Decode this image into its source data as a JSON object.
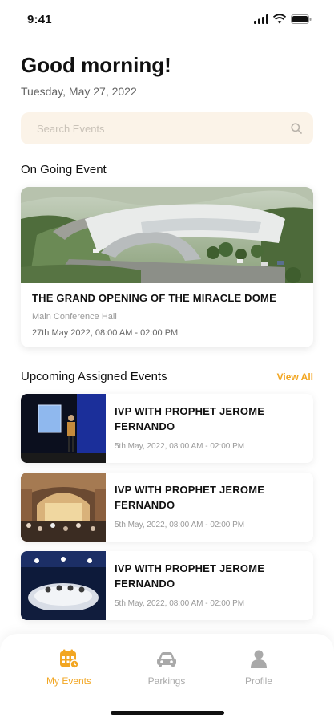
{
  "status_bar": {
    "time": "9:41"
  },
  "header": {
    "greeting": "Good morning!",
    "date": "Tuesday, May 27, 2022"
  },
  "search": {
    "placeholder": "Search Events"
  },
  "ongoing": {
    "section_title": "On Going Event",
    "event": {
      "title": "THE GRAND OPENING OF THE MIRACLE DOME",
      "venue": "Main Conference Hall",
      "time": "27th May 2022, 08:00 AM -  02:00 PM"
    }
  },
  "upcoming": {
    "section_title": "Upcoming Assigned Events",
    "view_all": "View All",
    "events": [
      {
        "title": "IVP WITH PROPHET JEROME FERNANDO",
        "time": "5th May, 2022, 08:00 AM -  02:00 PM"
      },
      {
        "title": "IVP WITH PROPHET JEROME FERNANDO",
        "time": "5th May, 2022, 08:00 AM -  02:00 PM"
      },
      {
        "title": "IVP WITH PROPHET JEROME FERNANDO",
        "time": "5th May, 2022, 08:00 AM -  02:00 PM"
      }
    ]
  },
  "tabs": [
    {
      "label": "My Events",
      "icon": "calendar-icon",
      "active": true
    },
    {
      "label": "Parkings",
      "icon": "car-icon",
      "active": false
    },
    {
      "label": "Profile",
      "icon": "person-icon",
      "active": false
    }
  ],
  "colors": {
    "accent": "#f2a622",
    "search_bg": "#fbf3e8"
  }
}
